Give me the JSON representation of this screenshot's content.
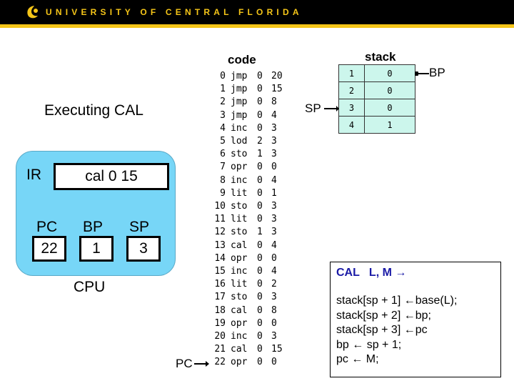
{
  "header": {
    "institution": "UNIVERSITY OF CENTRAL FLORIDA",
    "logo_icon": "pegasus-logo-icon",
    "brand_color": "#f5c518"
  },
  "title": "Executing CAL",
  "cpu": {
    "label": "CPU",
    "ir_label": "IR",
    "ir_value": "cal 0 15",
    "pc_label": "PC",
    "pc_value": "22",
    "bp_label": "BP",
    "bp_value": "1",
    "sp_label": "SP",
    "sp_value": "3",
    "color": "#77d6f7"
  },
  "code": {
    "title": "code",
    "pointer_label": "PC",
    "rows": [
      {
        "n": "0",
        "op": "jmp",
        "l": "0",
        "m": "20"
      },
      {
        "n": "1",
        "op": "jmp",
        "l": "0",
        "m": "15"
      },
      {
        "n": "2",
        "op": "jmp",
        "l": "0",
        "m": "8"
      },
      {
        "n": "3",
        "op": "jmp",
        "l": "0",
        "m": "4"
      },
      {
        "n": "4",
        "op": "inc",
        "l": "0",
        "m": "3"
      },
      {
        "n": "5",
        "op": "lod",
        "l": "2",
        "m": "3"
      },
      {
        "n": "6",
        "op": "sto",
        "l": "1",
        "m": "3"
      },
      {
        "n": "7",
        "op": "opr",
        "l": "0",
        "m": "0"
      },
      {
        "n": "8",
        "op": "inc",
        "l": "0",
        "m": "4"
      },
      {
        "n": "9",
        "op": "lit",
        "l": "0",
        "m": "1"
      },
      {
        "n": "10",
        "op": "sto",
        "l": "0",
        "m": "3"
      },
      {
        "n": "11",
        "op": "lit",
        "l": "0",
        "m": "3"
      },
      {
        "n": "12",
        "op": "sto",
        "l": "1",
        "m": "3"
      },
      {
        "n": "13",
        "op": "cal",
        "l": "0",
        "m": "4"
      },
      {
        "n": "14",
        "op": "opr",
        "l": "0",
        "m": "0"
      },
      {
        "n": "15",
        "op": "inc",
        "l": "0",
        "m": "4"
      },
      {
        "n": "16",
        "op": "lit",
        "l": "0",
        "m": "2"
      },
      {
        "n": "17",
        "op": "sto",
        "l": "0",
        "m": "3"
      },
      {
        "n": "18",
        "op": "cal",
        "l": "0",
        "m": "8"
      },
      {
        "n": "19",
        "op": "opr",
        "l": "0",
        "m": "0"
      },
      {
        "n": "20",
        "op": "inc",
        "l": "0",
        "m": "3"
      },
      {
        "n": "21",
        "op": "cal",
        "l": "0",
        "m": "15"
      },
      {
        "n": "22",
        "op": "opr",
        "l": "0",
        "m": "0"
      }
    ]
  },
  "stack": {
    "title": "stack",
    "sp_label": "SP",
    "bp_label": "BP",
    "rows": [
      {
        "idx": "1",
        "val": "0"
      },
      {
        "idx": "2",
        "val": "0"
      },
      {
        "idx": "3",
        "val": "0"
      },
      {
        "idx": "4",
        "val": "1"
      }
    ],
    "color": "#ccf6ec"
  },
  "cal_box": {
    "title": "CAL   L, M →",
    "lines": [
      "stack[sp + 1] ←base(L);",
      "stack[sp + 2] ←bp;",
      "stack[sp + 3] ←pc",
      "bp ← sp + 1;",
      "pc ← M;"
    ],
    "title_color": "#1a1aa6"
  }
}
